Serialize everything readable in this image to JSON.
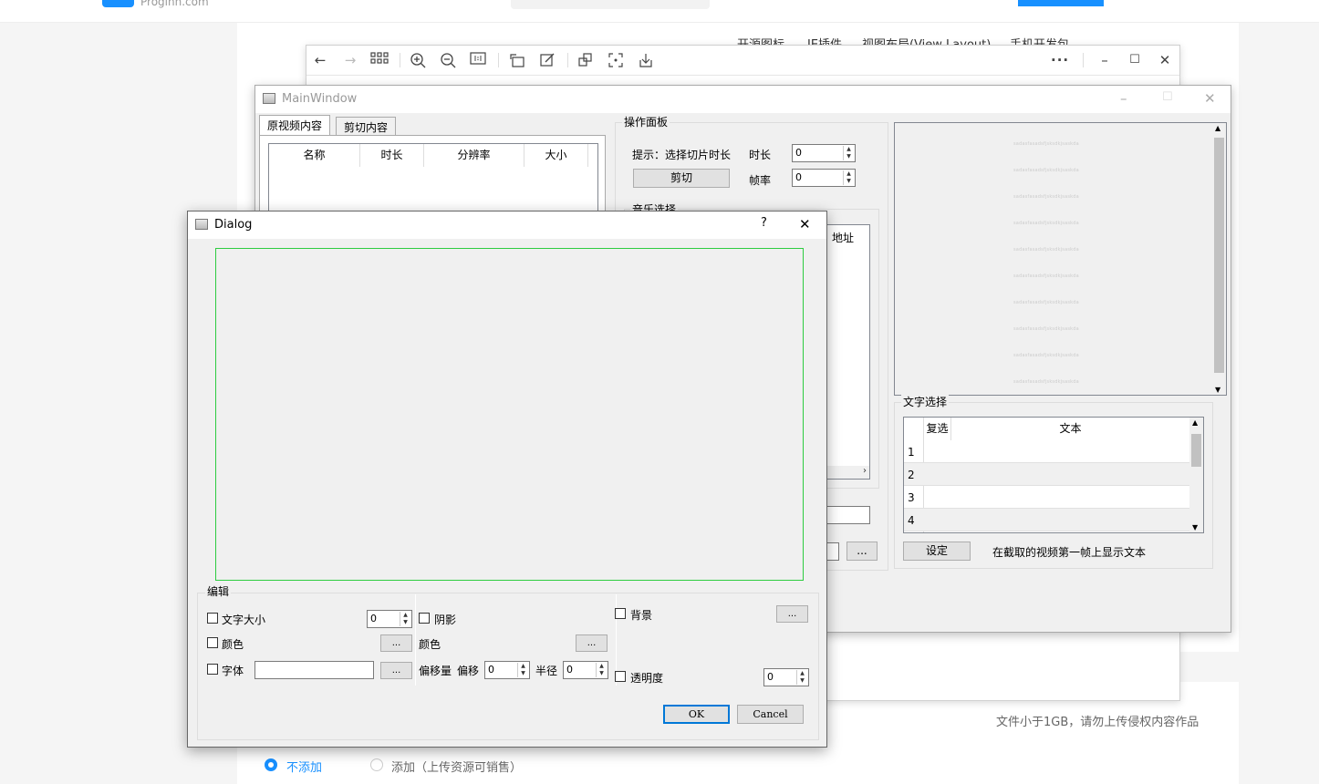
{
  "web": {
    "logo_text": "Proginn.com",
    "menu": [
      "开源图标",
      "IE插件",
      "视图布局(View Layout)",
      "手机开发包"
    ],
    "note": "文件小于1GB，请勿上传侵权内容作品",
    "option_no_add": "不添加",
    "option_add": "添加（上传资源可销售）"
  },
  "viewer": {
    "icons": [
      "back-arrow-icon",
      "forward-arrow-icon",
      "grid-icon",
      "zoom-in-icon",
      "zoom-out-icon",
      "actual-size-icon",
      "rotate-icon",
      "edit-icon",
      "crop-icon",
      "fullscreen-icon",
      "download-icon",
      "more-icon",
      "minimize-icon",
      "maximize-icon",
      "close-icon"
    ]
  },
  "main": {
    "title": "MainWindow",
    "tabs": [
      "原视频内容",
      "剪切内容"
    ],
    "video_table_headers": [
      "名称",
      "时长",
      "分辨率",
      "大小"
    ],
    "panel_title": "操作面板",
    "hint": "提示：选择切片时长",
    "duration_label": "时长",
    "duration_value": "0",
    "fps_label": "帧率",
    "fps_value": "0",
    "cut_button": "剪切",
    "music_group": "音乐选择",
    "music_header_address": "地址",
    "browse_label": "...",
    "preview_lines": [
      "sadasfasadsfjsksdkjsaskda",
      "sadasfasadsfjsksdkjsaskda",
      "sadasfasadsfjsksdkjsaskda",
      "sadasfasadsfjsksdkjsaskda",
      "sadasfasadsfjsksdkjsaskda",
      "sadasfasadsfjsksdkjsaskda",
      "sadasfasadsfjsksdkjsaskda",
      "sadasfasadsfjsksdkjsaskda",
      "sadasfasadsfjsksdkjsaskda",
      "sadasfasadsfjsksdkjsaskda"
    ],
    "text_group": "文字选择",
    "text_table_headers": [
      "复选",
      "文本"
    ],
    "text_rows": [
      "1",
      "2",
      "3",
      "4"
    ],
    "set_button": "设定",
    "set_hint": "在截取的视频第一帧上显示文本"
  },
  "dialog": {
    "title": "Dialog",
    "help": "?",
    "edit_group": "编辑",
    "font_size_label": "文字大小",
    "font_size_value": "0",
    "color_label": "颜色",
    "font_label": "字体",
    "shadow_label": "阴影",
    "shadow_color_label": "颜色",
    "offset_label": "偏移量",
    "offset_sub_label": "偏移",
    "offset_value": "0",
    "radius_label": "半径",
    "radius_value": "0",
    "background_label": "背景",
    "opacity_label": "透明度",
    "opacity_value": "0",
    "ellipsis": "...",
    "ok": "OK",
    "cancel": "Cancel"
  }
}
